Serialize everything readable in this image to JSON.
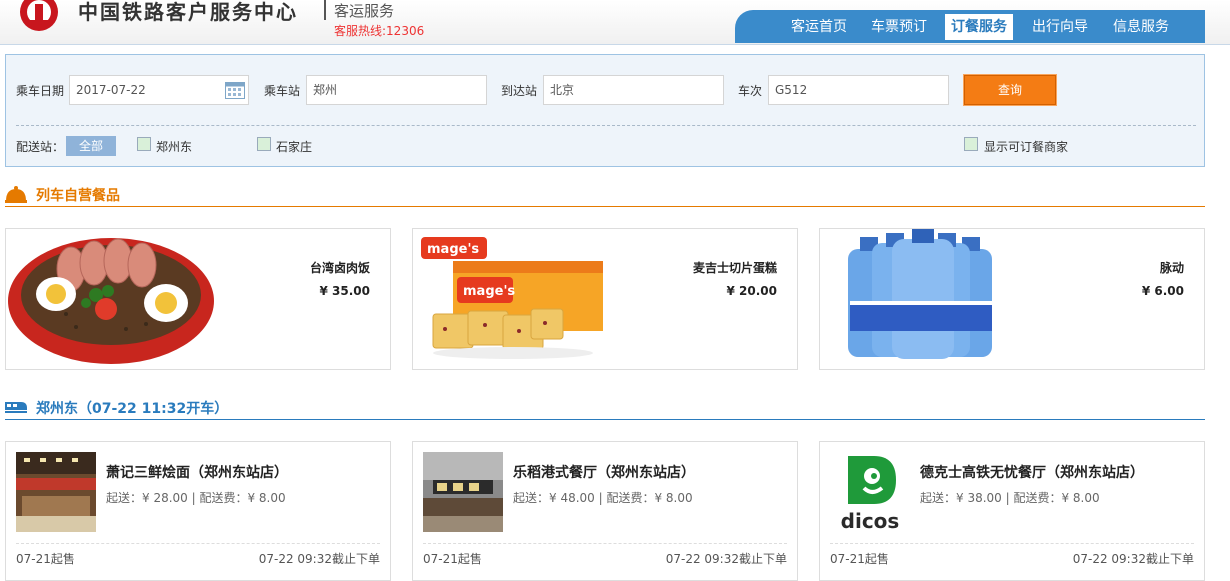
{
  "header": {
    "brand": "中国铁路客户服务中心",
    "sub": "客运服务",
    "hotline": "客服热线:12306",
    "nav": [
      "客运首页",
      "车票预订",
      "订餐服务",
      "出行向导",
      "信息服务"
    ],
    "active_nav": "订餐服务"
  },
  "search": {
    "date_label": "乘车日期",
    "date_value": "2017-07-22",
    "from_label": "乘车站",
    "from_value": "郑州",
    "to_label": "到达站",
    "to_value": "北京",
    "train_label": "车次",
    "train_value": "G512",
    "query_label": "查询",
    "station_label": "配送站：",
    "all_label": "全部",
    "stations": [
      "郑州东",
      "石家庄"
    ],
    "show_merchants_label": "显示可订餐商家"
  },
  "section_self": {
    "title": "列车自营餐品",
    "color": "#e57a00"
  },
  "products": [
    {
      "name": "台湾卤肉饭",
      "price": "¥ 35.00"
    },
    {
      "name": "麦吉士切片蛋糕",
      "price": "¥ 20.00"
    },
    {
      "name": "脉动",
      "price": "¥ 6.00"
    }
  ],
  "section_station": {
    "title": "郑州东（07-22 11:32开车）",
    "color": "#2a7bbd"
  },
  "restaurants": [
    {
      "name": "萧记三鲜烩面（郑州东站店）",
      "info": "起送：¥ 28.00 | 配送费：¥ 8.00",
      "start": "07-21起售",
      "cutoff": "07-22 09:32截止下单"
    },
    {
      "name": "乐稻港式餐厅（郑州东站店）",
      "info": "起送：¥ 48.00 | 配送费：¥ 8.00",
      "start": "07-21起售",
      "cutoff": "07-22 09:32截止下单"
    },
    {
      "name": "德克士高铁无忧餐厅（郑州东站店）",
      "info": "起送：¥ 38.00 | 配送费：¥ 8.00",
      "start": "07-21起售",
      "cutoff": "07-22 09:32截止下单",
      "logo_text": "dicos"
    }
  ],
  "product_images": {
    "cake_brand": "mage's"
  },
  "colors": {
    "nav_blue": "#3a8bcb",
    "query_orange": "#f47c14",
    "hotline_red": "#e33333"
  }
}
